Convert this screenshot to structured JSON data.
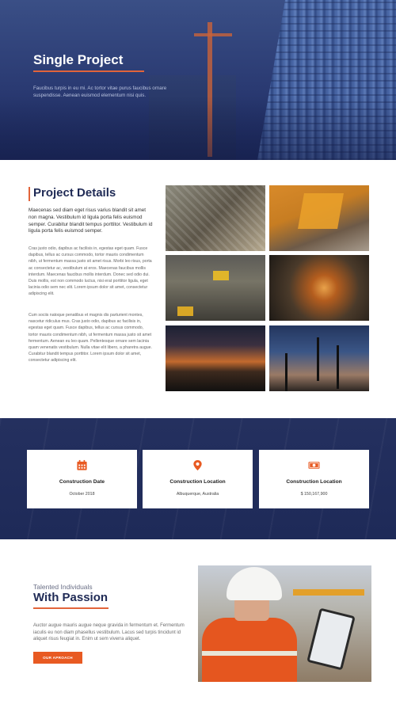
{
  "hero": {
    "title": "Single Project",
    "text": "Faucibus turpis in eu mi. Ac tortor vitae purus faucibus ornare suspendisse. Aenean euismod elementum nisi quis."
  },
  "details": {
    "title": "Project Details",
    "lead": "Maecenas sed diam eget risus varius blandit sit amet non magna. Vestibulum id ligula porta felis euismod semper. Curabitur blandit tempus porttitor. Vestibulum id ligula porta felis euismod semper.",
    "body1": "Cras justo odio, dapibus ac facilisis in, egestas eget quam. Fusce dapibus, tellus ac cursus commodo, tortor mauris condimentum nibh, ut fermentum massa justo sit amet risus. Morbi leo risus, porta ac consectetur ac, vestibulum at eros. Maecenas faucibus mollis interdum. Maecenas faucibus mollis interdum. Donec sed odio dui. Duis mollis, est non commodo luctus, nisi erat porttitor ligula, eget lacinia odio sem nec elit. Lorem ipsum dolor sit amet, consectetur adipiscing elit.",
    "body2": "Cum sociis natoque penatibus et magnis dis parturient montes, nascetur ridiculus mus. Cras justo odio, dapibus ac facilisis in, egestas eget quam. Fusce dapibus, tellus ac cursus commodo, tortor mauris condimentum nibh, ut fermentum massa justo sit amet fermentum. Aenean eu leo quam. Pellentesque ornare sem lacinia quam venenatis vestibulum. Nulla vitae elit libero, a pharetra augue. Curabitur blandit tempus porttitor. Lorem ipsum dolor sit amet, consectetur adipiscing elit."
  },
  "gallery": [
    "construction-site-aerial",
    "excavator-yellow",
    "quarry-trucks",
    "steel-mill-interior",
    "industrial-night-lights",
    "port-cranes-dusk"
  ],
  "stats": [
    {
      "icon": "calendar-icon",
      "title": "Construction Date",
      "value": "October 2018"
    },
    {
      "icon": "location-pin-icon",
      "title": "Construction Location",
      "value": "Albuquerque, Australia"
    },
    {
      "icon": "money-icon",
      "title": "Construction Location",
      "value": "$ 150,167,900"
    }
  ],
  "passion": {
    "subtitle": "Talented Individuals",
    "title": "With Passion",
    "text": "Auctor augue mauris augue neque gravida in fermentum et. Fermentum iaculis eu non diam phasellus vestibulum. Lacus sed turpis tincidunt id aliquet risus feugiat in. Enim ut sem viverra aliquet.",
    "button": "OUR APROACH"
  },
  "colors": {
    "accent": "#e2643a",
    "navy": "#1f2a55",
    "button": "#e85a22"
  }
}
